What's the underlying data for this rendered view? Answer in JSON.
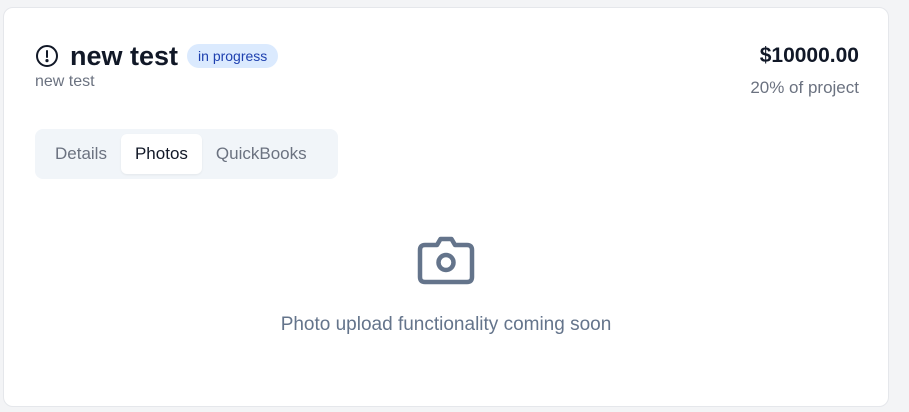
{
  "header": {
    "title": "new test",
    "status_badge": "in progress",
    "subtitle": "new test",
    "amount": "$10000.00",
    "percent_of_project": "20% of project"
  },
  "tabs": [
    {
      "label": "Details",
      "active": false
    },
    {
      "label": "Photos",
      "active": true
    },
    {
      "label": "QuickBooks",
      "active": false
    }
  ],
  "photos": {
    "icon": "camera-icon",
    "message": "Photo upload functionality coming soon"
  },
  "colors": {
    "badge_bg": "#dbeafe",
    "badge_text": "#1e40af",
    "muted_text": "#6b7280",
    "icon_gray": "#64748b"
  }
}
